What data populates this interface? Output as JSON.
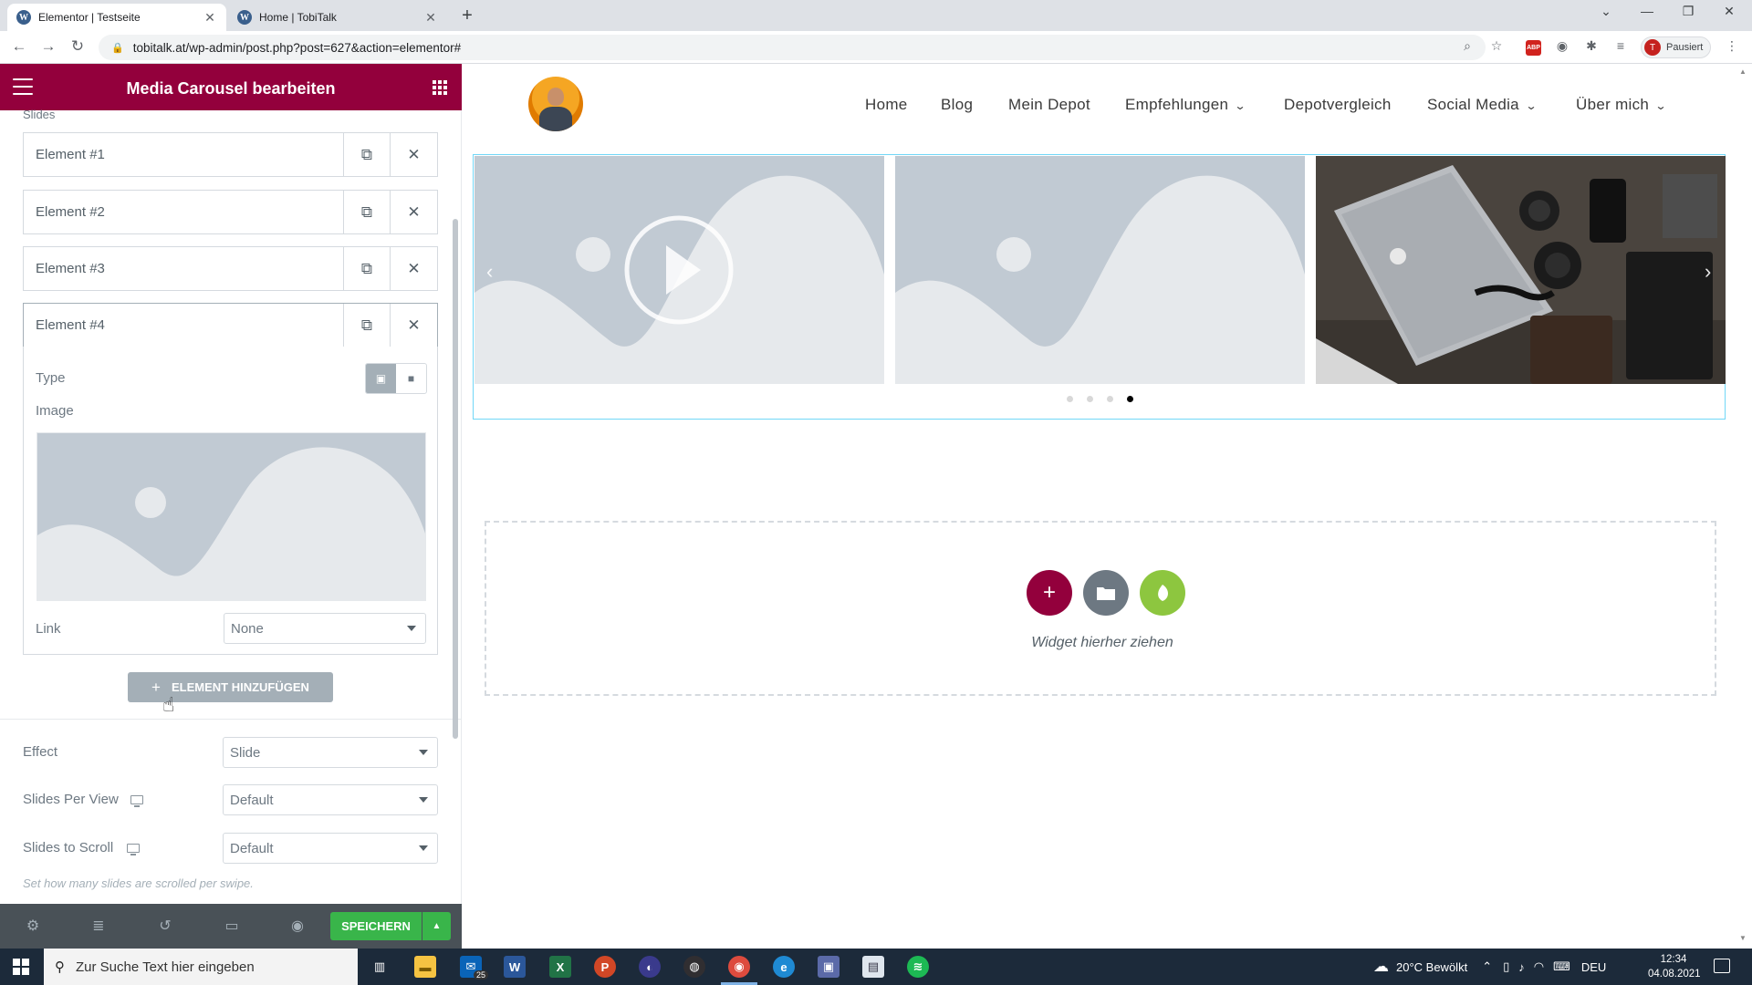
{
  "browser": {
    "tabs": [
      {
        "title": "Elementor | Testseite",
        "active": true
      },
      {
        "title": "Home | TobiTalk",
        "active": false
      }
    ],
    "url": "tobitalk.at/wp-admin/post.php?post=627&action=elementor#",
    "profile_label": "Pausiert",
    "profile_initial": "T",
    "abp_label": "ABP"
  },
  "panel": {
    "title": "Media Carousel bearbeiten",
    "slides_label": "Slides",
    "items": [
      {
        "label": "Element #1"
      },
      {
        "label": "Element #2"
      },
      {
        "label": "Element #3"
      },
      {
        "label": "Element #4"
      }
    ],
    "type_label": "Type",
    "image_label": "Image",
    "link_label": "Link",
    "link_value": "None",
    "add_button": "ELEMENT HINZUFÜGEN",
    "effect_label": "Effect",
    "effect_value": "Slide",
    "slides_per_view_label": "Slides Per View",
    "slides_per_view_value": "Default",
    "slides_to_scroll_label": "Slides to Scroll",
    "slides_to_scroll_value": "Default",
    "hint": "Set how many slides are scrolled per swipe.",
    "save_button": "SPEICHERN"
  },
  "site": {
    "nav": [
      {
        "label": "Home",
        "dropdown": false
      },
      {
        "label": "Blog",
        "dropdown": false
      },
      {
        "label": "Mein Depot",
        "dropdown": false
      },
      {
        "label": "Empfehlungen",
        "dropdown": true
      },
      {
        "label": "Depotvergleich",
        "dropdown": false
      },
      {
        "label": "Social Media",
        "dropdown": true
      },
      {
        "label": "Über mich",
        "dropdown": true
      }
    ],
    "carousel": {
      "slide_count": 4,
      "active_dot": 4
    },
    "dropzone_text": "Widget hierher ziehen"
  },
  "taskbar": {
    "search_placeholder": "Zur Suche Text hier eingeben",
    "mail_badge": "25",
    "weather": "20°C  Bewölkt",
    "language": "DEU",
    "time": "12:34",
    "date": "04.08.2021"
  },
  "colors": {
    "elementor_brand": "#93003c",
    "save_green": "#39b54a",
    "footer_bg": "#495157",
    "selection_outline": "#71d7f7",
    "add_green": "#8dc63f"
  }
}
